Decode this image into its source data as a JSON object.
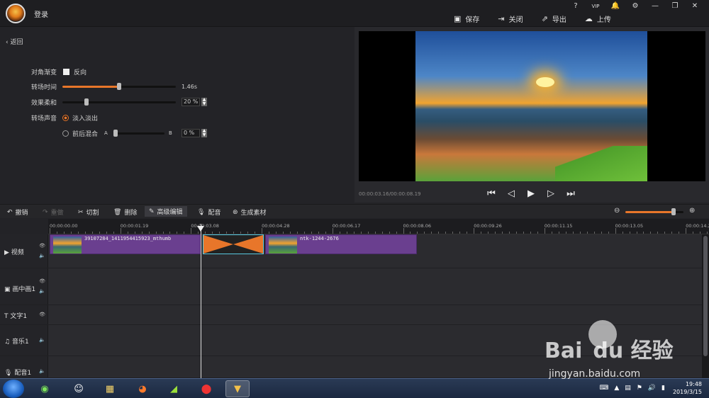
{
  "titlebar": {
    "login": "登录",
    "win_buttons": [
      "?",
      "VIP",
      "🔔",
      "⚙",
      "—",
      "❐",
      "✕"
    ],
    "actions": [
      {
        "label": "保存",
        "icon": "save-icon"
      },
      {
        "label": "关闭",
        "icon": "close-project-icon"
      },
      {
        "label": "导出",
        "icon": "export-icon"
      },
      {
        "label": "上传",
        "icon": "upload-icon"
      }
    ]
  },
  "panel": {
    "back": "返回",
    "diagonal_label": "对角渐变",
    "reverse_label": "反向",
    "duration_label": "转场时间",
    "duration_value": "1.46s",
    "duration_fraction": 0.5,
    "softness_label": "效果柔和",
    "softness_value": "20 %",
    "softness_fraction": 0.2,
    "sound_label": "转场声音",
    "fade_label": "淡入淡出",
    "mix_label": "前后混合",
    "mix_a": "A",
    "mix_b": "B",
    "mix_value": "0 %",
    "mix_fraction": 0.0
  },
  "preview": {
    "timecode": "00:00:03.16/00:00:08.19"
  },
  "edit_toolbar": {
    "undo": "撤销",
    "redo": "重做",
    "cut": "切割",
    "delete": "删除",
    "advanced": "高级编辑",
    "dub": "配音",
    "generate": "生成素材",
    "zoom_fraction": 0.85
  },
  "ruler": [
    "00:00:00.00",
    "00:00:01.19",
    "00:00:03.08",
    "00:00:04.28",
    "00:00:06.17",
    "00:00:08.06",
    "00:00:09.26",
    "00:00:11.15",
    "00:00:13.05",
    "00:00:14.2"
  ],
  "tracks": {
    "video": "视频",
    "pip": "画中画1",
    "text": "文字1",
    "music": "音乐1",
    "dub": "配音1"
  },
  "clips": {
    "clip1": "39107284_1411954415923_mthumb",
    "clip2": "ntk-1244-2676"
  },
  "taskbar": {
    "time": "19:48",
    "date": "2019/3/15"
  },
  "watermark": {
    "brand": "Bai du 经验",
    "url": "jingyan.baidu.com"
  }
}
